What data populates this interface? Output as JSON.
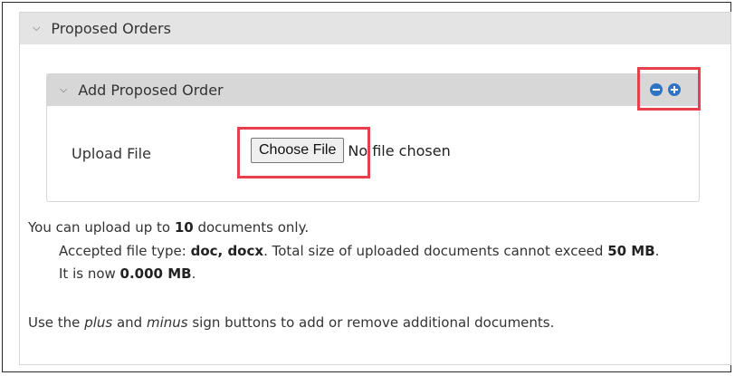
{
  "outer_panel": {
    "title": "Proposed Orders"
  },
  "inner_panel": {
    "title": "Add Proposed Order"
  },
  "upload": {
    "label": "Upload File",
    "button_label": "Choose File",
    "status": "No file chosen"
  },
  "info": {
    "line1_pre": "You can upload up to ",
    "max_docs": "10",
    "line1_post": " documents only.",
    "line2_pre": "Accepted file type: ",
    "file_types": "doc, docx",
    "line2_mid": ". Total size of uploaded documents cannot exceed ",
    "max_size": "50 MB",
    "line2_post": ".",
    "line3_pre": "It is now ",
    "current_size": "0.000 MB",
    "line3_post": ".",
    "line4_pre": "Use the ",
    "plus": "plus",
    "line4_mid1": " and ",
    "minus": "minus",
    "line4_post": " sign buttons to add or remove additional documents."
  },
  "colors": {
    "highlight": "#e8404a",
    "icon_blue": "#2f73c4"
  },
  "icons": [
    "minus-circle-icon",
    "plus-circle-icon",
    "chevron-down-icon"
  ]
}
